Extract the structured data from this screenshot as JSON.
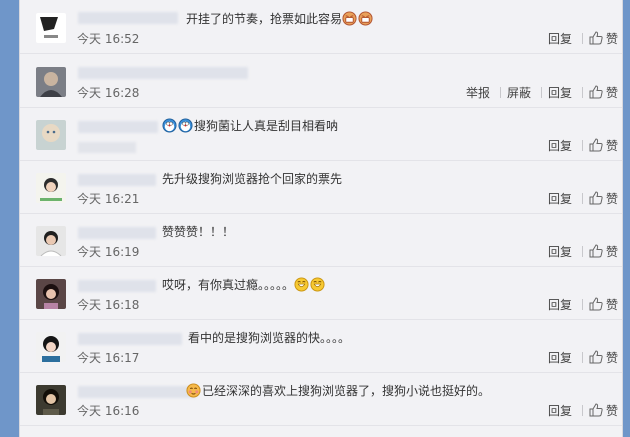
{
  "actions": {
    "reply": "回复",
    "like": "赞",
    "report": "举报",
    "block": "屏蔽"
  },
  "comments": [
    {
      "text": "开挂了的节奏，抢票如此容易",
      "time": "今天 16:52",
      "trailing_emoji": [
        "emoji-laugh-icon",
        "emoji-laugh-icon"
      ]
    },
    {
      "text": "",
      "time": "今天 16:28"
    },
    {
      "text": "搜狗菌让人真是刮目相看呐",
      "time": "",
      "leading_emoji": [
        "doraemon-icon",
        "doraemon-icon"
      ]
    },
    {
      "text": "先升级搜狗浏览器抢个回家的票先",
      "time": "今天 16:21"
    },
    {
      "text": "赞赞赞！！！",
      "time": "今天 16:19"
    },
    {
      "text": "哎呀，有你真过瘾。。。。。",
      "time": "今天 16:18",
      "trailing_emoji": [
        "emoji-grin-icon",
        "emoji-grin-icon"
      ]
    },
    {
      "text": "看中的是搜狗浏览器的快。。。。",
      "time": "今天 16:17"
    },
    {
      "text": "已经深深的喜欢上搜狗浏览器了，搜狗小说也挺好的。",
      "time": "今天 16:16",
      "leading_emoji": [
        "emoji-blush-icon"
      ]
    }
  ],
  "colors": {
    "background": "#6f96c9",
    "panel": "#f2f2f5",
    "text": "#333333",
    "muted": "#666666"
  }
}
